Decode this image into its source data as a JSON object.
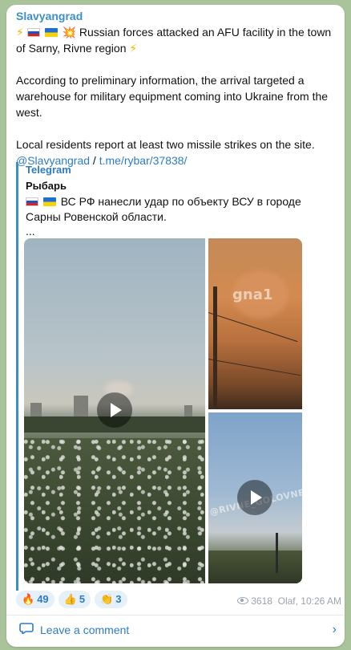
{
  "post": {
    "channel": "Slavyangrad",
    "headline": "Russian forces attacked an AFU facility in the town of Sarny, Rivne region",
    "paragraph1": "According to preliminary information, the arrival targeted a warehouse for military equipment coming into Ukraine from the west.",
    "paragraph2": "Local residents report at least two missile strikes on the site.",
    "link1": "@Slavyangrad",
    "separator": " / ",
    "link2": "t.me/rybar/37838/"
  },
  "quote": {
    "source": "Telegram",
    "author": "Рыбарь",
    "text": "ВС РФ нанесли удар по объекту ВСУ в городе Сарны Ровенской области.",
    "ellipsis": "..."
  },
  "media": {
    "watermark_top": "gna1",
    "watermark_side": "@RIVNE_GOLOVNE"
  },
  "reactions": [
    {
      "emoji": "🔥",
      "count": "49"
    },
    {
      "emoji": "👍",
      "count": "5"
    },
    {
      "emoji": "👏",
      "count": "3"
    }
  ],
  "meta": {
    "views": "3618",
    "author_time": "Olaf, 10:26 AM"
  },
  "comment": {
    "label": "Leave a comment",
    "chevron": "›"
  },
  "colors": {
    "accent": "#2c7cc6",
    "channel": "#3a8fc9"
  }
}
